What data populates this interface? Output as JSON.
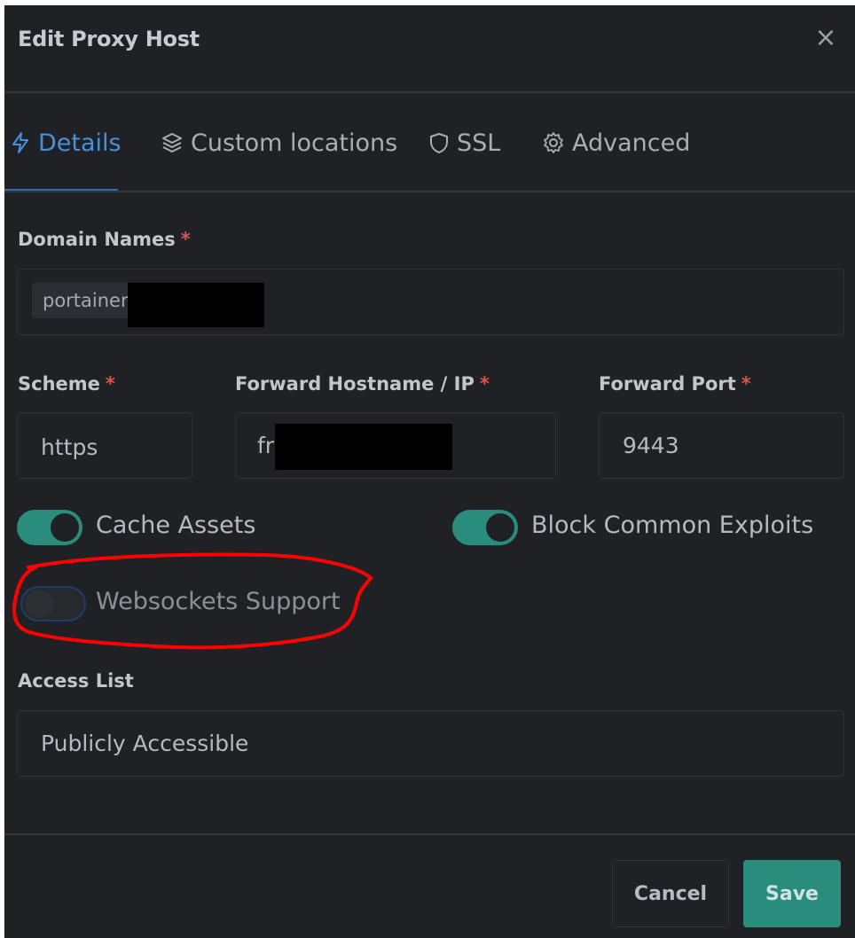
{
  "modal": {
    "title": "Edit Proxy Host",
    "close_label": "×"
  },
  "tabs": [
    {
      "label": "Details",
      "icon": "bolt-icon",
      "active": true
    },
    {
      "label": "Custom locations",
      "icon": "layers-icon",
      "active": false
    },
    {
      "label": "SSL",
      "icon": "shield-icon",
      "active": false
    },
    {
      "label": "Advanced",
      "icon": "gear-icon",
      "active": false
    }
  ],
  "form": {
    "domain_names": {
      "label": "Domain Names",
      "required": "*",
      "chip_value": "portainer"
    },
    "scheme": {
      "label": "Scheme",
      "required": "*",
      "value": "https"
    },
    "forward_host": {
      "label": "Forward Hostname / IP",
      "required": "*",
      "value": "fr"
    },
    "forward_port": {
      "label": "Forward Port",
      "required": "*",
      "value": "9443"
    },
    "toggles": {
      "cache_assets": {
        "label": "Cache Assets",
        "on": true
      },
      "block_exploits": {
        "label": "Block Common Exploits",
        "on": true
      },
      "websockets": {
        "label": "Websockets Support",
        "on": false
      }
    },
    "access_list": {
      "label": "Access List",
      "value": "Publicly Accessible"
    }
  },
  "footer": {
    "cancel_label": "Cancel",
    "save_label": "Save"
  },
  "colors": {
    "accent_teal": "#2a8c7d",
    "active_tab_blue": "#4a90d9",
    "required_red": "#d9534f",
    "annotation_red": "#ff0000"
  }
}
